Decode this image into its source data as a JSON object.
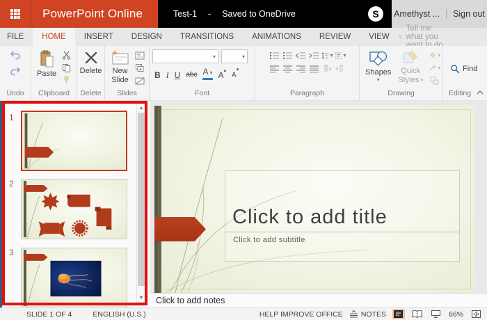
{
  "titlebar": {
    "app_name": "PowerPoint Online",
    "doc_title": "Test-1",
    "dash": "-",
    "save_status": "Saved to OneDrive",
    "account_name": "Amethyst ...",
    "sign_out_label": "Sign out"
  },
  "tabs": {
    "items": [
      {
        "label": "FILE"
      },
      {
        "label": "HOME"
      },
      {
        "label": "INSERT"
      },
      {
        "label": "DESIGN"
      },
      {
        "label": "TRANSITIONS"
      },
      {
        "label": "ANIMATIONS"
      },
      {
        "label": "REVIEW"
      },
      {
        "label": "VIEW"
      }
    ],
    "active": "HOME",
    "tell_me_placeholder": "Tell me what you want to do"
  },
  "ribbon": {
    "undo": {
      "label": "Undo"
    },
    "clipboard": {
      "paste_label": "Paste",
      "label": "Clipboard"
    },
    "delete": {
      "button_label": "Delete",
      "label": "Delete"
    },
    "slides": {
      "new_slide_label": "New Slide",
      "label": "Slides"
    },
    "font": {
      "label": "Font",
      "bold": "B",
      "italic": "I",
      "underline": "U",
      "strikethrough": "abc",
      "font_color": "A",
      "grow_font": "A",
      "shrink_font": "A"
    },
    "paragraph": {
      "label": "Paragraph"
    },
    "drawing": {
      "shapes_label": "Shapes",
      "quick_styles_label": "Quick Styles",
      "label": "Drawing"
    },
    "editing": {
      "find_label": "Find",
      "label": "Editing"
    }
  },
  "slide_panel": {
    "slides": [
      {
        "number": "1",
        "selected": true
      },
      {
        "number": "2",
        "selected": false
      },
      {
        "number": "3",
        "selected": false
      }
    ]
  },
  "canvas": {
    "title_placeholder": "Click to add title",
    "subtitle_placeholder": "Click to add subtitle"
  },
  "notes": {
    "placeholder": "Click to add notes"
  },
  "statusbar": {
    "slide_position": "SLIDE 1 OF 4",
    "language": "ENGLISH (U.S.)",
    "help_improve": "HELP IMPROVE OFFICE",
    "notes_label": "NOTES",
    "zoom_level": "66%"
  },
  "colors": {
    "brand_orange": "#d04423",
    "active_tab_text": "#c8401d",
    "accent_rust": "#b23a1d",
    "annotation_red": "#e01212",
    "selected_view_bg": "#f5c39a",
    "olive_bar": "#5d5b42"
  }
}
